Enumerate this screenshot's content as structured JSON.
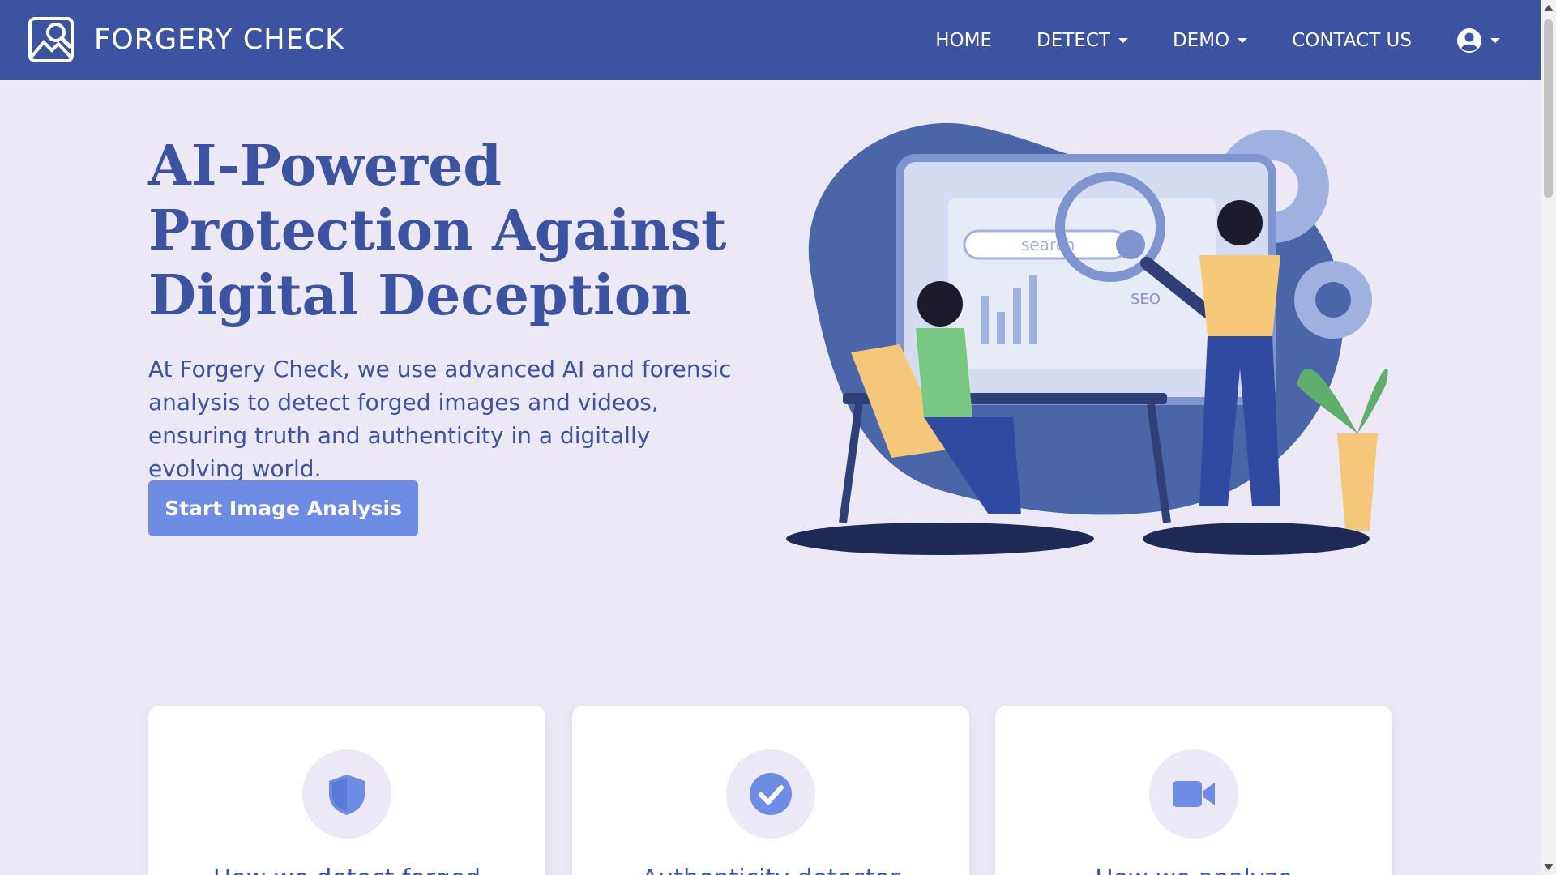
{
  "brand": {
    "name": "FORGERY CHECK"
  },
  "nav": {
    "home": "HOME",
    "detect": "DETECT",
    "demo": "DEMO",
    "contact": "CONTACT US"
  },
  "hero": {
    "title": "AI-Powered Protection Against Digital Deception",
    "text": "At Forgery Check, we use advanced AI and forensic analysis to detect forged images and videos, ensuring truth and authenticity in a digitally evolving world.",
    "cta": "Start Image Analysis",
    "illustration": {
      "search_placeholder": "search",
      "label": "SEO"
    }
  },
  "cards": [
    {
      "icon": "shield-icon",
      "title": "How we detect forged"
    },
    {
      "icon": "check-circle-icon",
      "title": "Authenticity detector"
    },
    {
      "icon": "video-camera-icon",
      "title": "How we analyze"
    }
  ],
  "colors": {
    "primary": "#3b53a1",
    "accent": "#6e8ce3",
    "background": "#ece8f5"
  }
}
